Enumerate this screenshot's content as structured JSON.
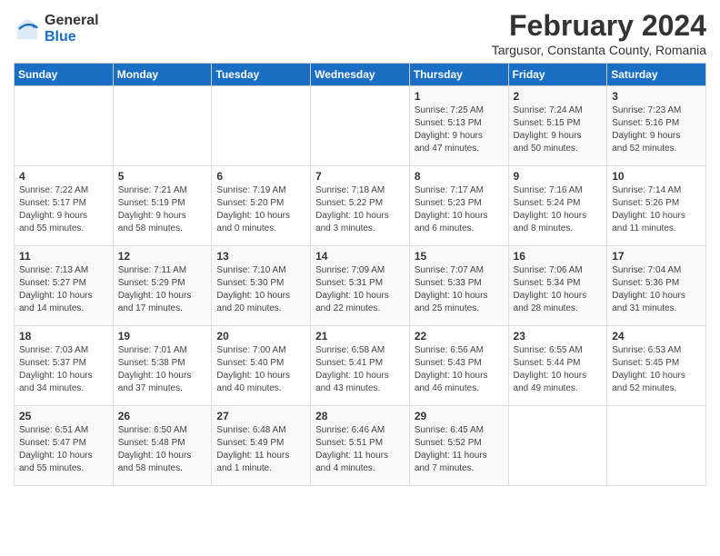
{
  "header": {
    "logo_general": "General",
    "logo_blue": "Blue",
    "title": "February 2024",
    "location": "Targusor, Constanta County, Romania"
  },
  "days_of_week": [
    "Sunday",
    "Monday",
    "Tuesday",
    "Wednesday",
    "Thursday",
    "Friday",
    "Saturday"
  ],
  "weeks": [
    [
      {
        "day": "",
        "info": ""
      },
      {
        "day": "",
        "info": ""
      },
      {
        "day": "",
        "info": ""
      },
      {
        "day": "",
        "info": ""
      },
      {
        "day": "1",
        "info": "Sunrise: 7:25 AM\nSunset: 5:13 PM\nDaylight: 9 hours\nand 47 minutes."
      },
      {
        "day": "2",
        "info": "Sunrise: 7:24 AM\nSunset: 5:15 PM\nDaylight: 9 hours\nand 50 minutes."
      },
      {
        "day": "3",
        "info": "Sunrise: 7:23 AM\nSunset: 5:16 PM\nDaylight: 9 hours\nand 52 minutes."
      }
    ],
    [
      {
        "day": "4",
        "info": "Sunrise: 7:22 AM\nSunset: 5:17 PM\nDaylight: 9 hours\nand 55 minutes."
      },
      {
        "day": "5",
        "info": "Sunrise: 7:21 AM\nSunset: 5:19 PM\nDaylight: 9 hours\nand 58 minutes."
      },
      {
        "day": "6",
        "info": "Sunrise: 7:19 AM\nSunset: 5:20 PM\nDaylight: 10 hours\nand 0 minutes."
      },
      {
        "day": "7",
        "info": "Sunrise: 7:18 AM\nSunset: 5:22 PM\nDaylight: 10 hours\nand 3 minutes."
      },
      {
        "day": "8",
        "info": "Sunrise: 7:17 AM\nSunset: 5:23 PM\nDaylight: 10 hours\nand 6 minutes."
      },
      {
        "day": "9",
        "info": "Sunrise: 7:16 AM\nSunset: 5:24 PM\nDaylight: 10 hours\nand 8 minutes."
      },
      {
        "day": "10",
        "info": "Sunrise: 7:14 AM\nSunset: 5:26 PM\nDaylight: 10 hours\nand 11 minutes."
      }
    ],
    [
      {
        "day": "11",
        "info": "Sunrise: 7:13 AM\nSunset: 5:27 PM\nDaylight: 10 hours\nand 14 minutes."
      },
      {
        "day": "12",
        "info": "Sunrise: 7:11 AM\nSunset: 5:29 PM\nDaylight: 10 hours\nand 17 minutes."
      },
      {
        "day": "13",
        "info": "Sunrise: 7:10 AM\nSunset: 5:30 PM\nDaylight: 10 hours\nand 20 minutes."
      },
      {
        "day": "14",
        "info": "Sunrise: 7:09 AM\nSunset: 5:31 PM\nDaylight: 10 hours\nand 22 minutes."
      },
      {
        "day": "15",
        "info": "Sunrise: 7:07 AM\nSunset: 5:33 PM\nDaylight: 10 hours\nand 25 minutes."
      },
      {
        "day": "16",
        "info": "Sunrise: 7:06 AM\nSunset: 5:34 PM\nDaylight: 10 hours\nand 28 minutes."
      },
      {
        "day": "17",
        "info": "Sunrise: 7:04 AM\nSunset: 5:36 PM\nDaylight: 10 hours\nand 31 minutes."
      }
    ],
    [
      {
        "day": "18",
        "info": "Sunrise: 7:03 AM\nSunset: 5:37 PM\nDaylight: 10 hours\nand 34 minutes."
      },
      {
        "day": "19",
        "info": "Sunrise: 7:01 AM\nSunset: 5:38 PM\nDaylight: 10 hours\nand 37 minutes."
      },
      {
        "day": "20",
        "info": "Sunrise: 7:00 AM\nSunset: 5:40 PM\nDaylight: 10 hours\nand 40 minutes."
      },
      {
        "day": "21",
        "info": "Sunrise: 6:58 AM\nSunset: 5:41 PM\nDaylight: 10 hours\nand 43 minutes."
      },
      {
        "day": "22",
        "info": "Sunrise: 6:56 AM\nSunset: 5:43 PM\nDaylight: 10 hours\nand 46 minutes."
      },
      {
        "day": "23",
        "info": "Sunrise: 6:55 AM\nSunset: 5:44 PM\nDaylight: 10 hours\nand 49 minutes."
      },
      {
        "day": "24",
        "info": "Sunrise: 6:53 AM\nSunset: 5:45 PM\nDaylight: 10 hours\nand 52 minutes."
      }
    ],
    [
      {
        "day": "25",
        "info": "Sunrise: 6:51 AM\nSunset: 5:47 PM\nDaylight: 10 hours\nand 55 minutes."
      },
      {
        "day": "26",
        "info": "Sunrise: 6:50 AM\nSunset: 5:48 PM\nDaylight: 10 hours\nand 58 minutes."
      },
      {
        "day": "27",
        "info": "Sunrise: 6:48 AM\nSunset: 5:49 PM\nDaylight: 11 hours\nand 1 minute."
      },
      {
        "day": "28",
        "info": "Sunrise: 6:46 AM\nSunset: 5:51 PM\nDaylight: 11 hours\nand 4 minutes."
      },
      {
        "day": "29",
        "info": "Sunrise: 6:45 AM\nSunset: 5:52 PM\nDaylight: 11 hours\nand 7 minutes."
      },
      {
        "day": "",
        "info": ""
      },
      {
        "day": "",
        "info": ""
      }
    ]
  ]
}
